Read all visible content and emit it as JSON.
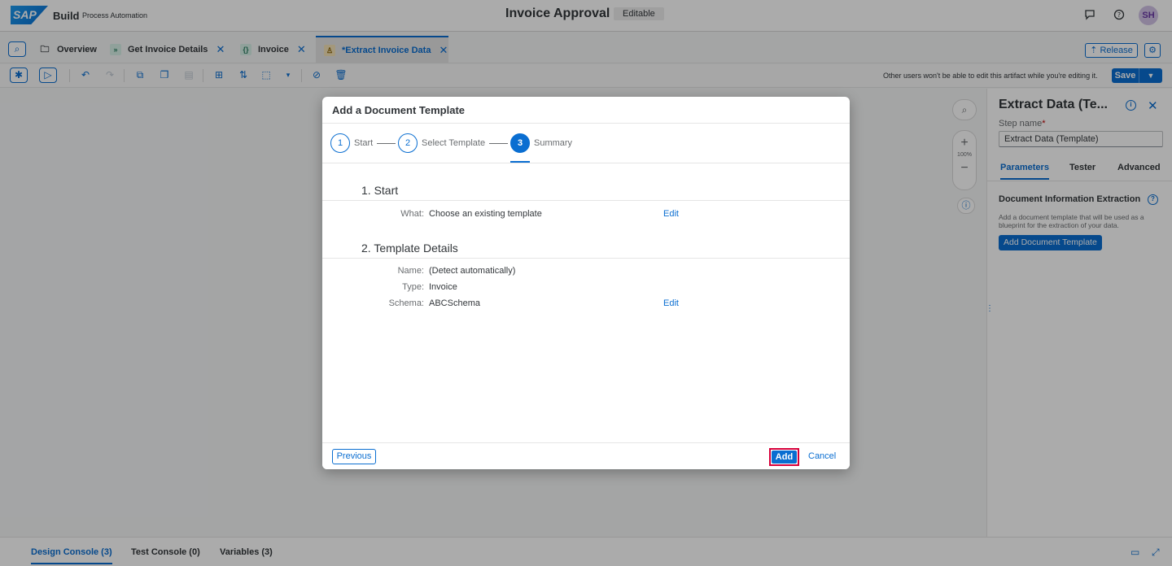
{
  "shell": {
    "logo": "SAP",
    "brand": "Build",
    "brand_sub": "Process Automation",
    "title": "Invoice Approval",
    "badge": "Editable",
    "avatar": "SH"
  },
  "tabs": [
    {
      "label": "Overview",
      "icon": "folder-icon",
      "closable": false
    },
    {
      "label": "Get Invoice Details",
      "icon": "trigger-icon",
      "closable": true
    },
    {
      "label": "Invoice",
      "icon": "data-type-icon",
      "closable": true
    },
    {
      "label": "*Extract Invoice Data",
      "icon": "automation-icon",
      "closable": true,
      "active": true
    }
  ],
  "tab_actions": {
    "release": "Release"
  },
  "toolbar": {
    "note": "Other users won't be able to edit this artifact while you're editing it.",
    "save": "Save"
  },
  "canvas": {
    "zoom_pct": "100%"
  },
  "right_panel": {
    "title": "Extract Data (Te...",
    "step_name_label": "Step name",
    "required_marker": "*",
    "step_name_value": "Extract Data (Template)",
    "tabs": [
      "Parameters",
      "Tester",
      "Advanced"
    ],
    "section_title": "Document Information Extraction",
    "description": "Add a document template that will be used as a blueprint for the extraction of your data.",
    "add_button": "Add Document Template"
  },
  "bottom_tabs": [
    "Design Console (3)",
    "Test Console (0)",
    "Variables (3)"
  ],
  "dialog": {
    "title": "Add a Document Template",
    "steps": [
      {
        "num": "1",
        "label": "Start"
      },
      {
        "num": "2",
        "label": "Select Template"
      },
      {
        "num": "3",
        "label": "Summary"
      }
    ],
    "section1": {
      "title": "1. Start",
      "fields": [
        {
          "label": "What:",
          "value": "Choose an existing template"
        }
      ],
      "edit": "Edit"
    },
    "section2": {
      "title": "2. Template Details",
      "fields": [
        {
          "label": "Name:",
          "value": "(Detect automatically)"
        },
        {
          "label": "Type:",
          "value": "Invoice"
        },
        {
          "label": "Schema:",
          "value": "ABCSchema"
        }
      ],
      "edit": "Edit"
    },
    "footer": {
      "previous": "Previous",
      "add": "Add",
      "cancel": "Cancel"
    }
  },
  "colors": {
    "accent": "#0a6ed1",
    "highlight": "#d7003a"
  }
}
